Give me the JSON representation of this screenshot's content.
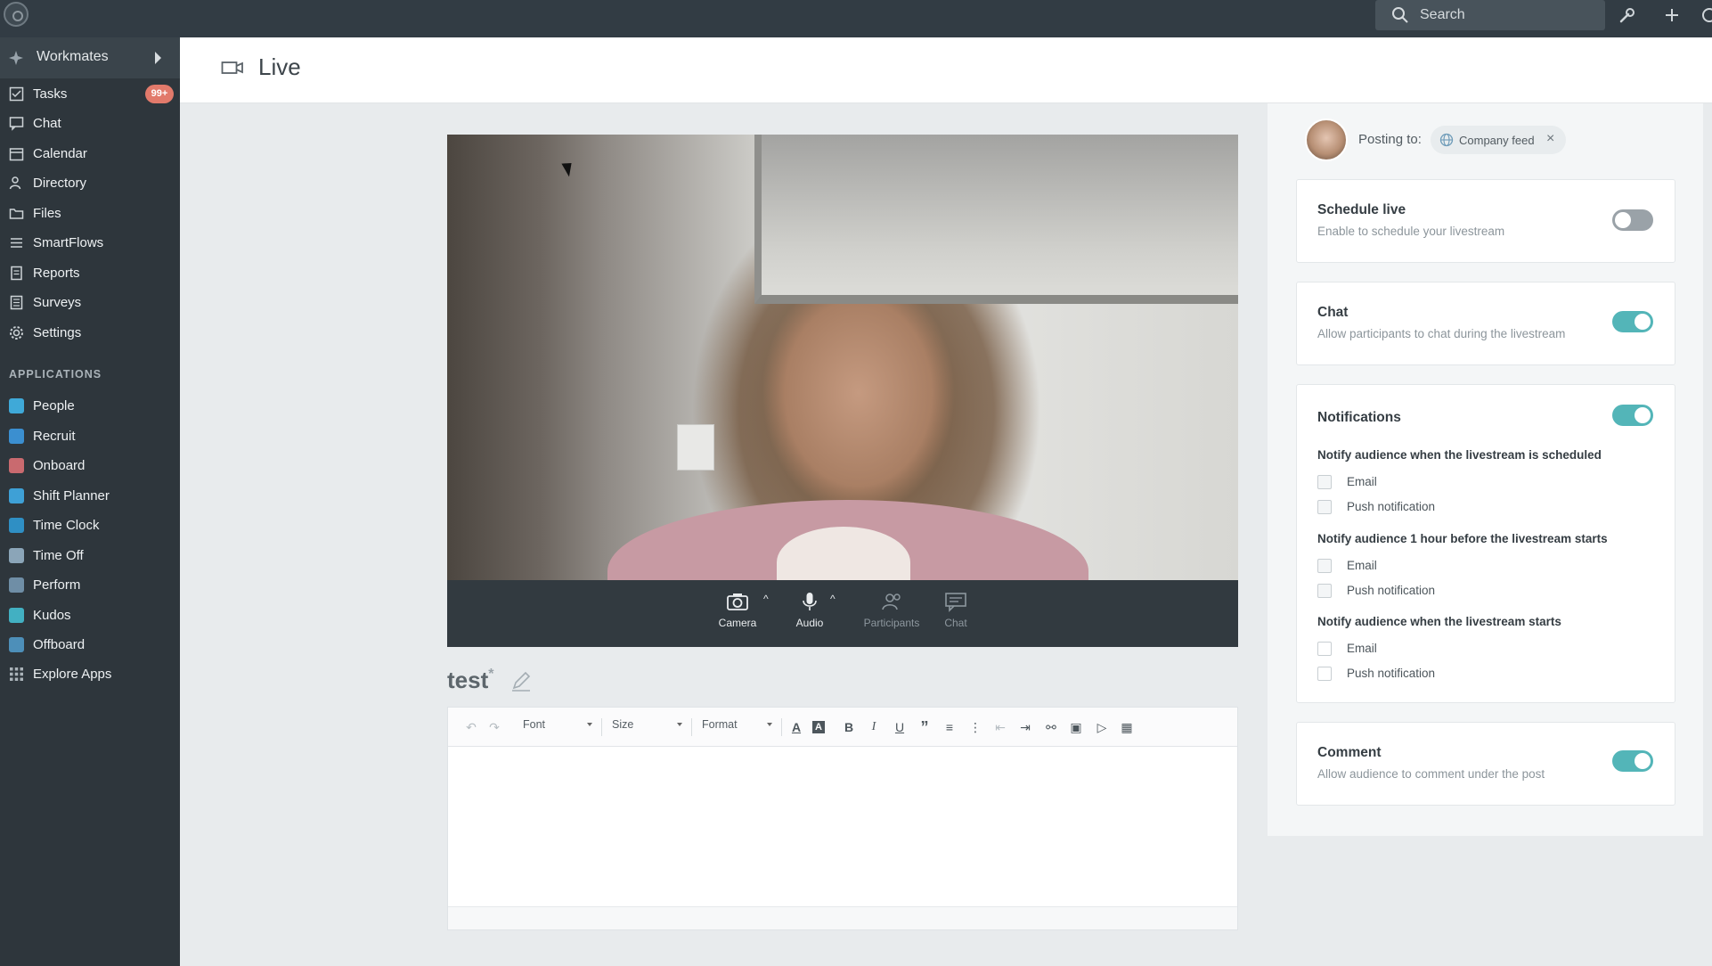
{
  "topbar": {
    "search_placeholder": "Search"
  },
  "sidebar": {
    "workspace": "Workmates",
    "nav": [
      {
        "label": "Tasks",
        "icon": "checkbox-icon",
        "badge": "99+"
      },
      {
        "label": "Chat",
        "icon": "chat-icon"
      },
      {
        "label": "Calendar",
        "icon": "calendar-icon"
      },
      {
        "label": "Directory",
        "icon": "people-icon"
      },
      {
        "label": "Files",
        "icon": "folder-icon"
      },
      {
        "label": "SmartFlows",
        "icon": "flow-icon"
      },
      {
        "label": "Reports",
        "icon": "report-icon"
      },
      {
        "label": "Surveys",
        "icon": "survey-icon"
      },
      {
        "label": "Settings",
        "icon": "gear-icon"
      }
    ],
    "applications_label": "APPLICATIONS",
    "apps": [
      {
        "label": "People",
        "color": "#3fa9d8"
      },
      {
        "label": "Recruit",
        "color": "#3b8fd0"
      },
      {
        "label": "Onboard",
        "color": "#c96a6f"
      },
      {
        "label": "Shift Planner",
        "color": "#3ea0d6"
      },
      {
        "label": "Time Clock",
        "color": "#2f8fc4"
      },
      {
        "label": "Time Off",
        "color": "#8ba5b8"
      },
      {
        "label": "Perform",
        "color": "#6f8ea6"
      },
      {
        "label": "Kudos",
        "color": "#42b0c2"
      },
      {
        "label": "Offboard",
        "color": "#4d8fb9"
      },
      {
        "label": "Explore Apps",
        "color": "#aab3b9"
      }
    ]
  },
  "header": {
    "title": "Live"
  },
  "video_controls": {
    "camera": "Camera",
    "audio": "Audio",
    "participants": "Participants",
    "chat": "Chat"
  },
  "post": {
    "title": "test",
    "required_mark": "*"
  },
  "editor": {
    "font": "Font",
    "size": "Size",
    "format": "Format"
  },
  "right_panel": {
    "posting_label": "Posting to:",
    "target": "Company feed",
    "schedule": {
      "title": "Schedule live",
      "desc": "Enable to schedule your livestream",
      "enabled": false
    },
    "chat": {
      "title": "Chat",
      "desc": "Allow participants to chat during the livestream",
      "enabled": true
    },
    "notifications": {
      "title": "Notifications",
      "enabled": true,
      "groups": [
        {
          "heading": "Notify audience when the livestream is scheduled",
          "email": "Email",
          "push": "Push notification"
        },
        {
          "heading": "Notify audience 1 hour before the livestream starts",
          "email": "Email",
          "push": "Push notification"
        },
        {
          "heading": "Notify audience when the livestream starts",
          "email": "Email",
          "push": "Push notification"
        }
      ]
    },
    "comment": {
      "title": "Comment",
      "desc": "Allow audience to comment under the post",
      "enabled": true
    }
  },
  "colors": {
    "accent_toggle": "#53b5b8",
    "sidebar_bg": "#2e363c",
    "topbar_bg": "#323c44",
    "badge": "#e27a6b"
  }
}
